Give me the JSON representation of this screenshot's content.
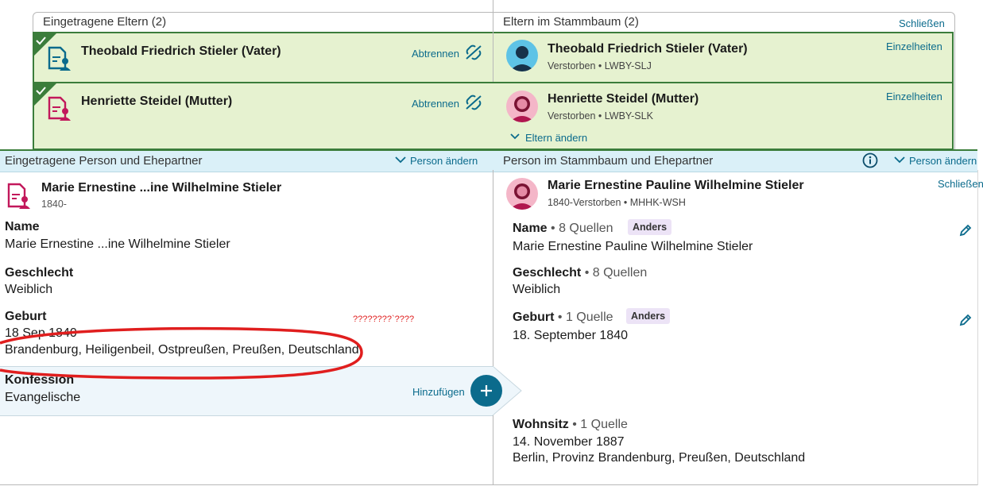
{
  "parents": {
    "left_title": "Eingetragene Eltern (2)",
    "right_title": "Eltern im Stammbaum (2)",
    "close_label": "Schließen",
    "rows": [
      {
        "left_name": "Theobald Friedrich Stieler (Vater)",
        "detach_label": "Abtrennen",
        "right_name": "Theobald Friedrich Stieler (Vater)",
        "right_meta": "Verstorben • LWBY-SLJ",
        "details_label": "Einzelheiten"
      },
      {
        "left_name": "Henriette Steidel (Mutter)",
        "detach_label": "Abtrennen",
        "right_name": "Henriette Steidel (Mutter)",
        "right_meta": "Verstorben • LWBY-SLK",
        "details_label": "Einzelheiten"
      }
    ],
    "change_parents_label": "Eltern ändern"
  },
  "person_band": {
    "left_title": "Eingetragene Person und Ehepartner",
    "left_change": "Person ändern",
    "right_title": "Person im Stammbaum und Ehepartner",
    "right_change": "Person ändern"
  },
  "left_person": {
    "name": "Marie Ernestine ...ine Wilhelmine Stieler",
    "years": "1840-",
    "name_label": "Name",
    "name_value": "Marie Ernestine ...ine Wilhelmine Stieler",
    "gender_label": "Geschlecht",
    "gender_value": "Weiblich",
    "birth_label": "Geburt",
    "birth_date": "18 Sep 1840",
    "birth_place": "Brandenburg, Heiligenbeil, Ostpreußen, Preußen, Deutschland",
    "annotation": "????????`????",
    "religion_label": "Konfession",
    "religion_value": "Evangelische",
    "add_label": "Hinzufügen"
  },
  "right_person": {
    "name": "Marie Ernestine Pauline Wilhelmine Stieler",
    "meta": "1840-Verstorben • MHHK-WSH",
    "close_label": "Schließen",
    "name_label": "Name",
    "name_sources": " • 8 Quellen",
    "name_tag": "Anders",
    "name_value": "Marie Ernestine Pauline Wilhelmine Stieler",
    "gender_label": "Geschlecht",
    "gender_sources": " • 8 Quellen",
    "gender_value": "Weiblich",
    "birth_label": "Geburt",
    "birth_sources": " • 1 Quelle",
    "birth_tag": "Anders",
    "birth_value": "18. September 1840",
    "residence_label": "Wohnsitz",
    "residence_sources": " • 1 Quelle",
    "residence_date": "14. November 1887",
    "residence_place": "Berlin, Provinz Brandenburg, Preußen, Deutschland"
  },
  "colors": {
    "accent": "#0b6b8c",
    "green_bg": "#e6f2d0",
    "green_border": "#3b7d3b",
    "band_bg": "#daf0f8",
    "annotation_red": "#e01e1e",
    "female": "#c2185b"
  }
}
